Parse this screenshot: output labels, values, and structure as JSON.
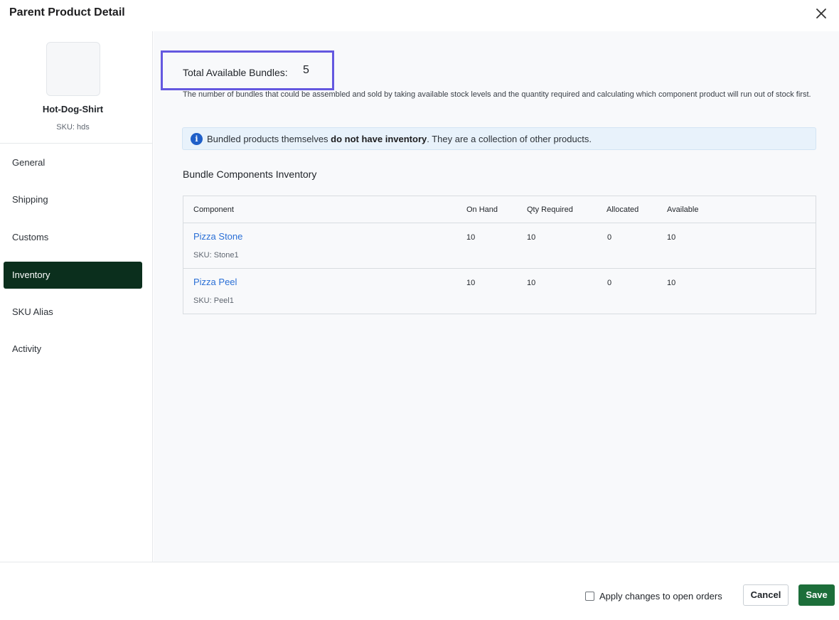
{
  "header": {
    "title": "Parent Product Detail",
    "close_icon": "close-icon"
  },
  "product": {
    "name": "Hot-Dog-Shirt",
    "sku": "SKU: hds"
  },
  "nav": {
    "items": [
      {
        "label": "General",
        "active": false
      },
      {
        "label": "Shipping",
        "active": false
      },
      {
        "label": "Customs",
        "active": false
      },
      {
        "label": "Inventory",
        "active": true
      },
      {
        "label": "SKU Alias",
        "active": false
      },
      {
        "label": "Activity",
        "active": false
      }
    ]
  },
  "bundles": {
    "total_label": "Total Available Bundles:",
    "total_value": "5",
    "description": "The number of bundles that could be assembled and sold by taking available stock levels and the quantity required and calculating which component product will run out of stock first."
  },
  "info": {
    "icon": "info-icon",
    "prefix": "Bundled products themselves ",
    "bold": "do not have inventory",
    "suffix": ". They are a collection of other products."
  },
  "components": {
    "title": "Bundle Components Inventory",
    "headers": [
      "Component",
      "On Hand",
      "Qty Required",
      "Allocated",
      "Available"
    ],
    "rows": [
      {
        "name": "Pizza Stone",
        "sku": "SKU: Stone1",
        "on_hand": "10",
        "qty_required": "10",
        "allocated": "0",
        "available": "10"
      },
      {
        "name": "Pizza Peel",
        "sku": "SKU: Peel1",
        "on_hand": "10",
        "qty_required": "10",
        "allocated": "0",
        "available": "10"
      }
    ]
  },
  "footer": {
    "apply_label": "Apply changes to open orders",
    "apply_checked": false,
    "cancel_label": "Cancel",
    "save_label": "Save"
  },
  "colors": {
    "nav_active_bg": "#0b2f1d",
    "save_bg": "#1c6e3a",
    "link": "#2a6fd6",
    "highlight_border": "#6458e0",
    "info_bg": "#e8f2fb",
    "info_icon": "#1f5fc8"
  }
}
